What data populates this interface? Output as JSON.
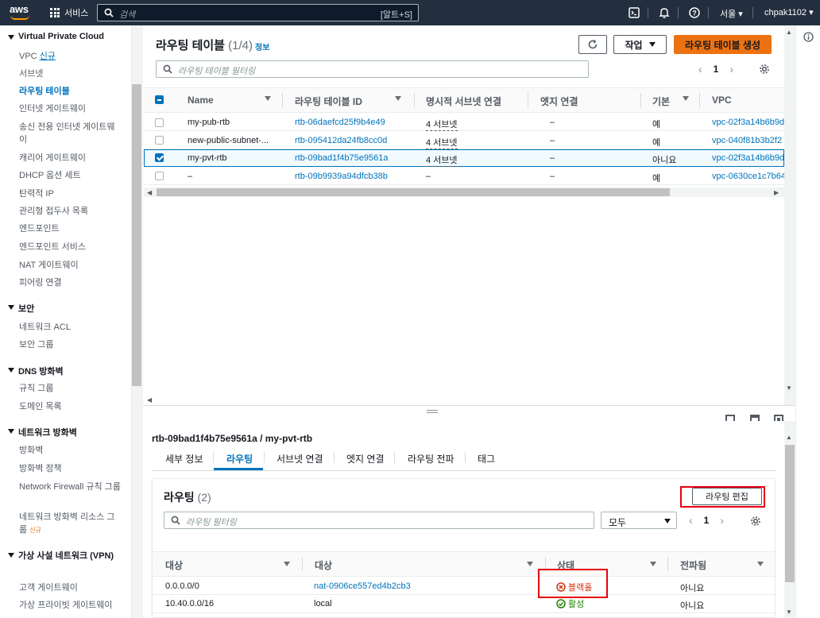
{
  "topbar": {
    "logo": "aws",
    "services_label": "서비스",
    "search_placeholder": "검색",
    "search_shortcut": "[알트+S]",
    "region": "서울",
    "user": "chpak1102"
  },
  "sidebar": {
    "section_title": "Virtual Private Cloud",
    "vpc_items": [
      {
        "label": "VPC",
        "badge": "신규"
      },
      {
        "label": "서브넷"
      },
      {
        "label": "라우팅 테이블"
      },
      {
        "label": "인터넷 게이트웨이"
      },
      {
        "label": "송신 전용 인터넷 게이트웨이"
      },
      {
        "label": "캐리어 게이트웨이"
      },
      {
        "label": "DHCP 옵션 세트"
      },
      {
        "label": "탄력적 IP"
      },
      {
        "label": "관리형 접두사 목록"
      },
      {
        "label": "엔드포인트"
      },
      {
        "label": "엔드포인트 서비스"
      },
      {
        "label": "NAT 게이트웨이"
      },
      {
        "label": "피어링 연결"
      }
    ],
    "security_title": "보안",
    "security_items": [
      "네트워크 ACL",
      "보안 그룹"
    ],
    "dns_title": "DNS 방화벽",
    "dns_items": [
      "규칙 그룹",
      "도메인 목록"
    ],
    "nfw_title": "네트워크 방화벽",
    "nfw_items": [
      "방화벽",
      "방화벽 정책",
      "Network Firewall 규칙 그룹",
      "네트워크 방화벽 리소스 그룹"
    ],
    "nfw_badge": "신규",
    "vpn_title": "가상 사설 네트워크 (VPN)",
    "vpn_items": [
      "고객 게이트웨이",
      "가상 프라이빗 게이트웨이"
    ]
  },
  "main": {
    "title": "라우팅 테이블",
    "count": "(1/4)",
    "info": "정보",
    "actions_label": "작업",
    "create_label": "라우팅 테이블 생성",
    "filter_placeholder": "라우팅 테이블 필터링",
    "page": "1",
    "columns": [
      "Name",
      "라우팅 테이블 ID",
      "명시적 서브넷 연결",
      "엣지 연결",
      "기본",
      "VPC"
    ],
    "rows": [
      {
        "name": "my-pub-rtb",
        "id": "rtb-06daefcd25f9b4e49",
        "subnets": "4 서브넷",
        "edge": "–",
        "main": "예",
        "vpc": "vpc-02f3a14b6b9d",
        "selected": false
      },
      {
        "name": "new-public-subnet-...",
        "id": "rtb-095412da24fb8cc0d",
        "subnets": "4 서브넷",
        "edge": "–",
        "main": "예",
        "vpc": "vpc-040f81b3b2f2",
        "selected": false
      },
      {
        "name": "my-pvt-rtb",
        "id": "rtb-09bad1f4b75e9561a",
        "subnets": "4 서브넷",
        "edge": "–",
        "main": "아니요",
        "vpc": "vpc-02f3a14b6b9d",
        "selected": true
      },
      {
        "name": "–",
        "id": "rtb-09b9939a94dfcb38b",
        "subnets": "–",
        "edge": "–",
        "main": "예",
        "vpc": "vpc-0630ce1c7b64",
        "selected": false
      }
    ]
  },
  "detail": {
    "title": "rtb-09bad1f4b75e9561a / my-pvt-rtb",
    "tabs": [
      "세부 정보",
      "라우팅",
      "서브넷 연결",
      "엣지 연결",
      "라우팅 전파",
      "태그"
    ],
    "active_tab": "라우팅",
    "routes_title": "라우팅",
    "routes_count": "(2)",
    "edit_label": "라우팅 편집",
    "filter_placeholder": "라우팅 필터링",
    "select_value": "모두",
    "page": "1",
    "columns": [
      "대상",
      "대상",
      "상태",
      "전파됨"
    ],
    "routes": [
      {
        "destination": "0.0.0.0/0",
        "target": "nat-0906ce557ed4b2cb3",
        "status": "블랙홀",
        "propagated": "아니요"
      },
      {
        "destination": "10.40.0.0/16",
        "target": "local",
        "status": "활성",
        "propagated": "아니요"
      }
    ]
  },
  "colors": {
    "accent": "#0073bb",
    "primary": "#ec7211",
    "topbar": "#232f3e",
    "error": "#d13212",
    "success": "#1d8102",
    "highlight": "#e60012"
  }
}
